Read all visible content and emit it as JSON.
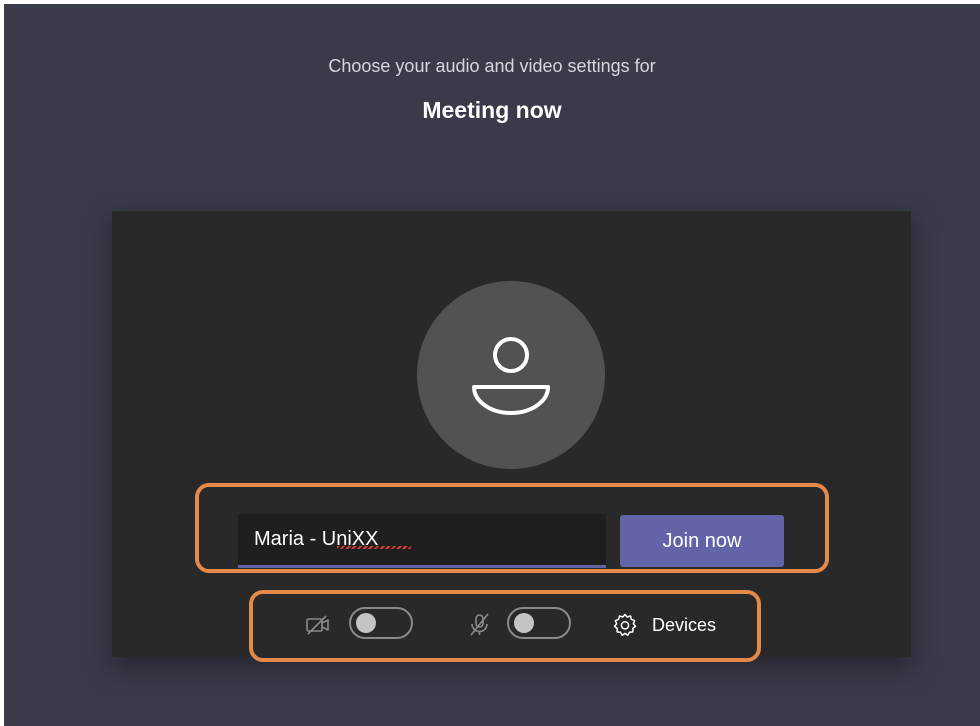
{
  "header": {
    "subtitle": "Choose your audio and video settings for",
    "meeting_title": "Meeting now"
  },
  "join": {
    "name_value": "Maria - UniXX",
    "join_label": "Join now"
  },
  "controls": {
    "camera_icon": "camera-off-icon",
    "camera_toggle_on": false,
    "mic_icon": "mic-off-icon",
    "mic_toggle_on": false,
    "devices_icon": "gear-icon",
    "devices_label": "Devices"
  },
  "colors": {
    "background": "#393a4a",
    "panel": "#292929",
    "accent": "#6264a7",
    "highlight": "#e3894a"
  }
}
